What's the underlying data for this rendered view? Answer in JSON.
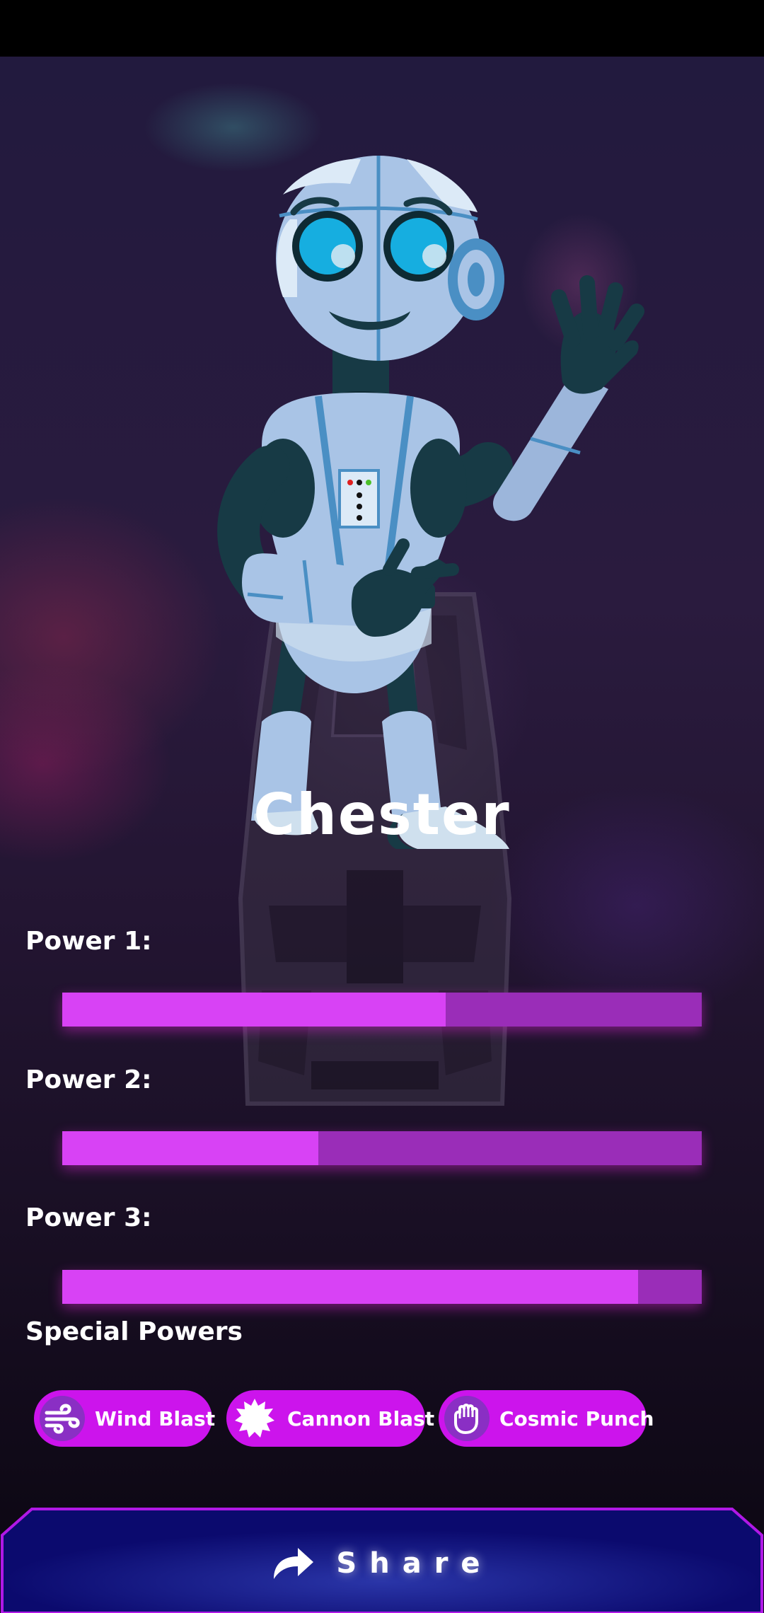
{
  "character": {
    "name": "Chester"
  },
  "powers": [
    {
      "label": "Power 1:",
      "level": 0.6
    },
    {
      "label": "Power 2:",
      "level": 0.4
    },
    {
      "label": "Power 3:",
      "level": 0.9
    }
  ],
  "special_powers": {
    "title": "Special Powers",
    "items": [
      {
        "label": "Wind Blast",
        "icon": "wind-icon"
      },
      {
        "label": "Cannon Blast",
        "icon": "burst-icon"
      },
      {
        "label": "Cosmic Punch",
        "icon": "fist-icon"
      }
    ]
  },
  "share": {
    "label": "Share",
    "icon": "share-arrow-icon"
  },
  "colors": {
    "accent": "#d842f5",
    "bar_track": "#9a2db8",
    "chip": "#cc14ec",
    "share_panel": "#0b0a6e",
    "share_border": "#b018e6"
  }
}
